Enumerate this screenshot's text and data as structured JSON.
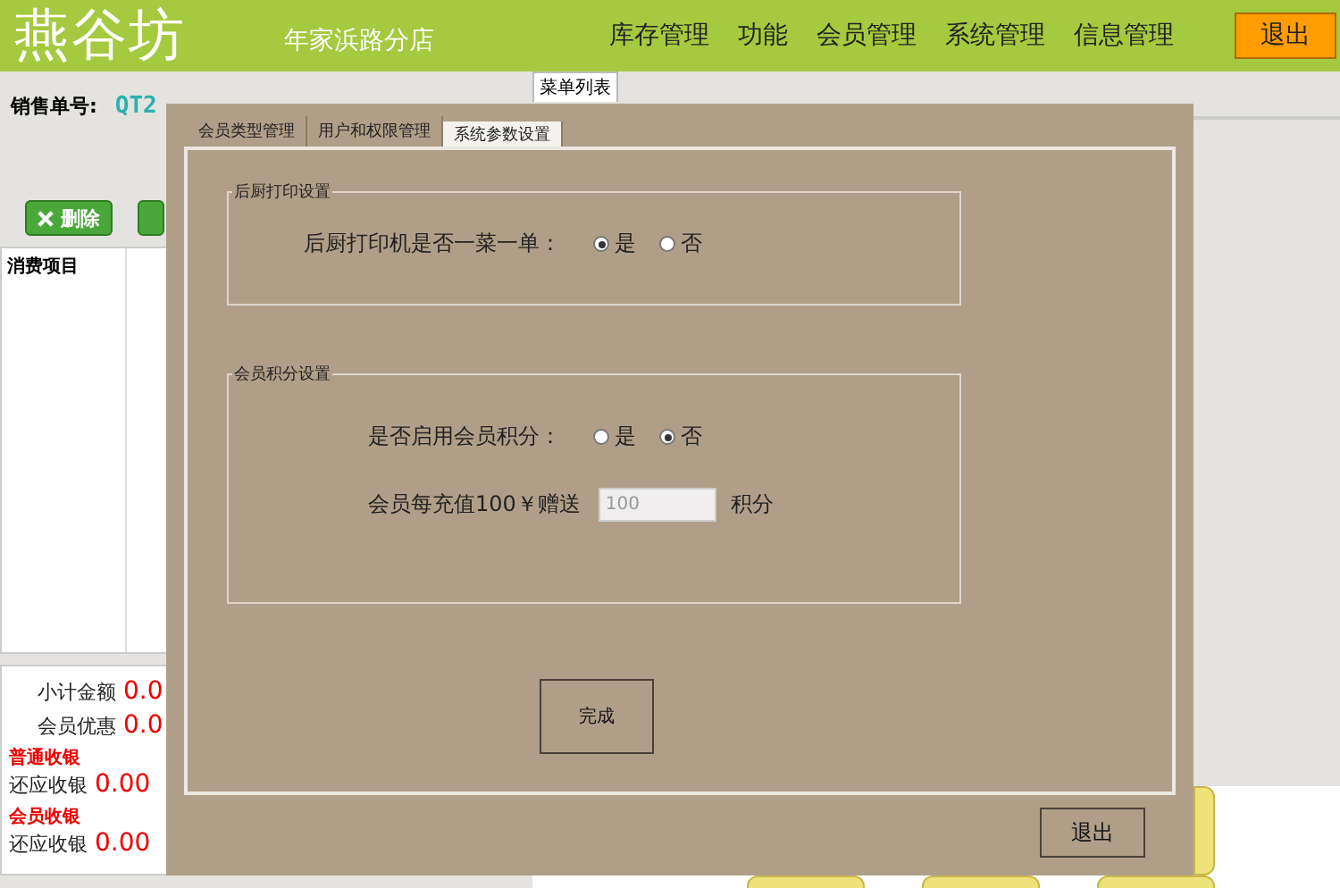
{
  "header": {
    "logo": "燕谷坊",
    "branch": "年家浜路分店",
    "menu": [
      {
        "label": "库存管理"
      },
      {
        "label": "功能"
      },
      {
        "label": "会员管理"
      },
      {
        "label": "系统管理"
      },
      {
        "label": "信息管理"
      }
    ],
    "logout": "退出"
  },
  "order": {
    "label": "销售单号:",
    "number": "QT2"
  },
  "menu_list_tab": "菜单列表",
  "toolbar": [
    {
      "kind": "delete",
      "label": "删除"
    },
    {
      "kind": "add"
    }
  ],
  "table": {
    "columns": [
      "消费项目"
    ]
  },
  "summary": [
    {
      "kind": "row",
      "label": "小计金额",
      "value": "0.0"
    },
    {
      "kind": "row",
      "label": "会员优惠",
      "value": "0.0"
    },
    {
      "kind": "heading",
      "label": "普通收银"
    },
    {
      "kind": "row",
      "label": "还应收银",
      "value": "0.00"
    },
    {
      "kind": "heading",
      "label": "会员收银"
    },
    {
      "kind": "row",
      "label": "还应收银",
      "value": "0.00"
    }
  ],
  "dialog": {
    "tabs": [
      {
        "label": "会员类型管理",
        "selected": false
      },
      {
        "label": "用户和权限管理",
        "selected": false
      },
      {
        "label": "系统参数设置",
        "selected": true
      }
    ],
    "groups": [
      {
        "legend": "后厨打印设置",
        "rows": [
          {
            "kind": "radio",
            "label": "后厨打印机是否一菜一单：",
            "options": [
              {
                "label": "是",
                "selected": true
              },
              {
                "label": "否",
                "selected": false
              }
            ]
          }
        ]
      },
      {
        "legend": "会员积分设置",
        "rows": [
          {
            "kind": "radio",
            "label": "是否启用会员积分：",
            "options": [
              {
                "label": "是",
                "selected": false
              },
              {
                "label": "否",
                "selected": true
              }
            ]
          },
          {
            "kind": "input",
            "label": "会员每充值100￥赠送",
            "value": "100",
            "unit": "积分"
          }
        ]
      }
    ],
    "done": "完成",
    "exit": "退出"
  }
}
